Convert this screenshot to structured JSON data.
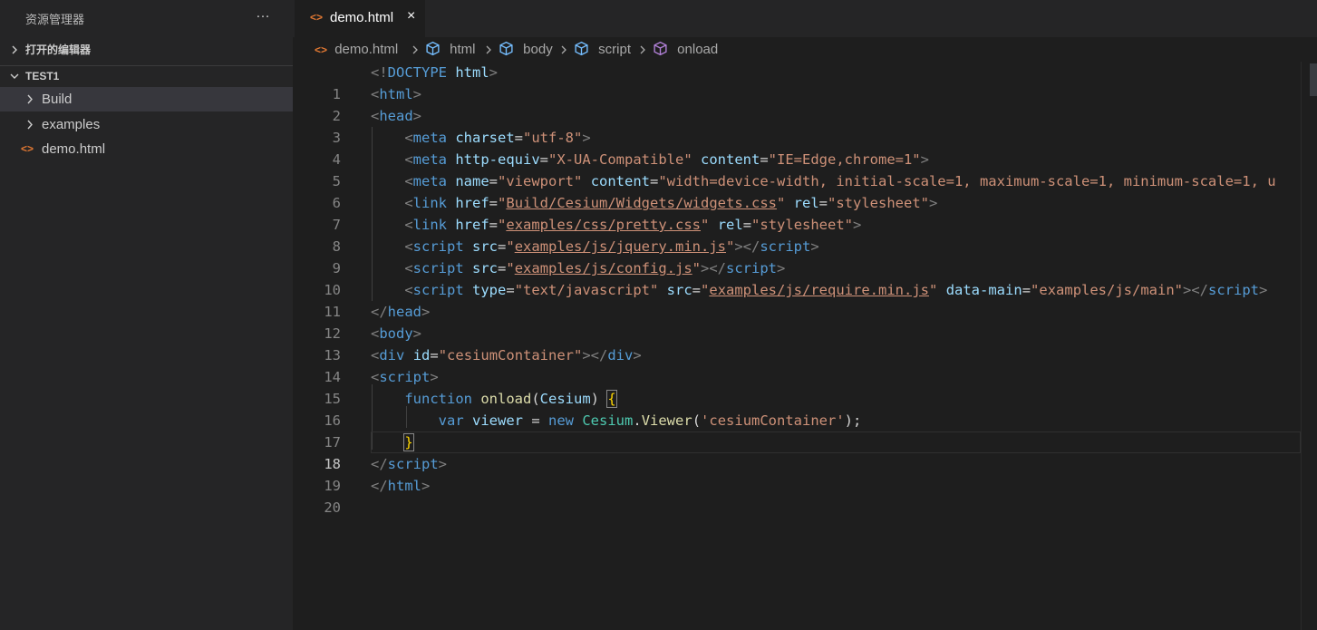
{
  "sidebar": {
    "title": "资源管理器",
    "more_icon": "…",
    "open_editors_label": "打开的编辑器",
    "workspace_label": "TEST1",
    "items": [
      {
        "label": "Build",
        "type": "folder"
      },
      {
        "label": "examples",
        "type": "folder"
      },
      {
        "label": "demo.html",
        "type": "file"
      }
    ]
  },
  "tab": {
    "label": "demo.html",
    "icon": "<>",
    "close_icon": "×"
  },
  "breadcrumb": [
    "demo.html",
    "html",
    "body",
    "script",
    "onload"
  ],
  "editor": {
    "line_numbers": [
      "1",
      "2",
      "3",
      "4",
      "5",
      "6",
      "7",
      "8",
      "9",
      "10",
      "11",
      "12",
      "13",
      "14",
      "15",
      "16",
      "17",
      "18",
      "19",
      "20"
    ],
    "current_line": 18
  },
  "colors": {
    "background": "#1e1e1e",
    "sidebar": "#252526",
    "selected_item": "#37373d",
    "tag": "#569cd6",
    "attribute": "#9cdcfe",
    "string": "#ce9178",
    "function": "#dcdcaa",
    "class": "#4ec9b0",
    "html_icon": "#e37933"
  },
  "code": {
    "l1": {
      "open": "<!",
      "tag": "DOCTYPE",
      "attr": "html",
      "close": ">"
    },
    "l2": {
      "open": "<",
      "tag": "html",
      "close": ">"
    },
    "l3": {
      "open": "<",
      "tag": "head",
      "close": ">"
    },
    "l4": {
      "open": "<",
      "tag": "meta",
      "a1": "charset",
      "eq": "=",
      "v1": "\"utf-8\"",
      "close": ">"
    },
    "l5": {
      "open": "<",
      "tag": "meta",
      "a1": "http-equiv",
      "v1": "\"X-UA-Compatible\"",
      "a2": "content",
      "v2": "\"IE=Edge,chrome=1\"",
      "close": ">"
    },
    "l6": {
      "open": "<",
      "tag": "meta",
      "a1": "name",
      "v1": "\"viewport\"",
      "a2": "content",
      "v2": "\"width=device-width, initial-scale=1, maximum-scale=1, minimum-scale=1, u"
    },
    "l7": {
      "open": "<",
      "tag": "link",
      "a1": "href",
      "q": "\"",
      "v1": "Build/Cesium/Widgets/widgets.css",
      "a2": "rel",
      "v2": "\"stylesheet\"",
      "close": ">"
    },
    "l8": {
      "open": "<",
      "tag": "link",
      "a1": "href",
      "q": "\"",
      "v1": "examples/css/pretty.css",
      "a2": "rel",
      "v2": "\"stylesheet\"",
      "close": ">"
    },
    "l9": {
      "open": "<",
      "tag": "script",
      "a1": "src",
      "q": "\"",
      "v1": "examples/js/jquery.min.js",
      "mid": "></",
      "close": ">"
    },
    "l10": {
      "open": "<",
      "tag": "script",
      "a1": "src",
      "q": "\"",
      "v1": "examples/js/config.js",
      "mid": "></",
      "close": ">"
    },
    "l11": {
      "open": "<",
      "tag": "script",
      "a1": "type",
      "v1": "\"text/javascript\"",
      "a2": "src",
      "q": "\"",
      "v2": "examples/js/require.min.js",
      "a3": "data-main",
      "v3": "\"examples/js/main\"",
      "mid": "></",
      "close": ">"
    },
    "l12": {
      "open": "</",
      "tag": "head",
      "close": ">"
    },
    "l13": {
      "open": "<",
      "tag": "body",
      "close": ">"
    },
    "l14": {
      "open": "<",
      "tag": "div",
      "a1": "id",
      "v1": "\"cesiumContainer\"",
      "mid": "></",
      "tag2": "div",
      "close": ">"
    },
    "l15": {
      "open": "<",
      "tag": "script",
      "close": ">"
    },
    "l16": {
      "kw": "function",
      "fn": "onload",
      "p1": "(",
      "param": "Cesium",
      "p2": ") ",
      "brace": "{"
    },
    "l17": {
      "kw": "var",
      "var": "viewer",
      "eq": " = ",
      "kw2": "new",
      "cls": "Cesium",
      "dot": ".",
      "fn": "Viewer",
      "p1": "(",
      "str": "'cesiumContainer'",
      "p2": ");"
    },
    "l18": {
      "brace": "}"
    },
    "l19": {
      "open": "</",
      "tag": "script",
      "close": ">"
    },
    "l20": {
      "open": "</",
      "tag": "html",
      "close": ">"
    }
  }
}
